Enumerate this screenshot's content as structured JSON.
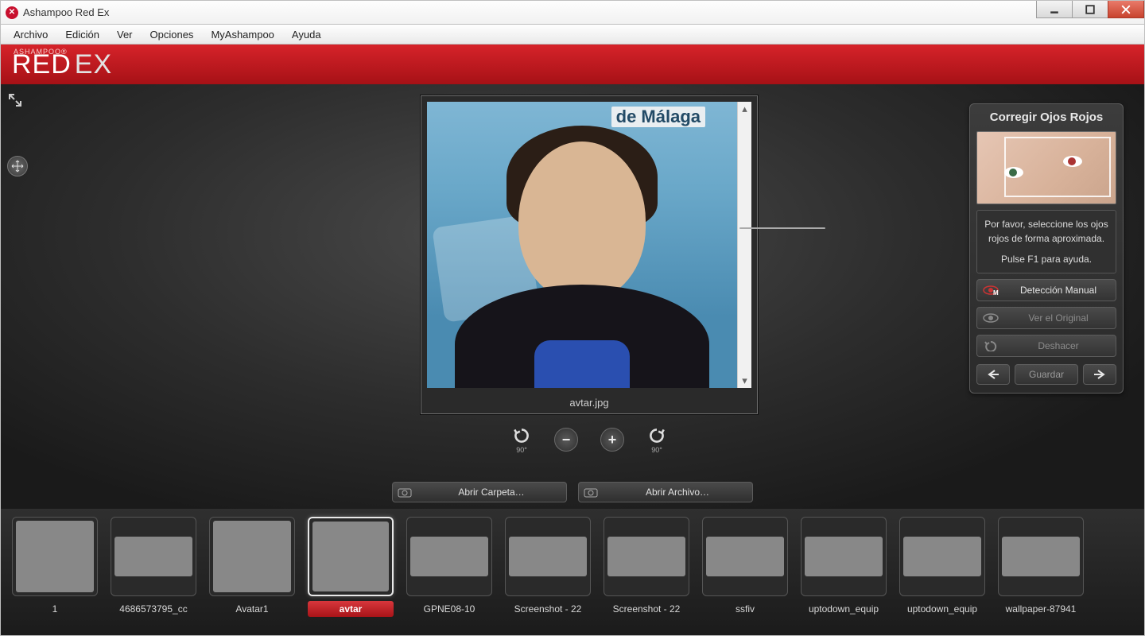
{
  "window": {
    "title": "Ashampoo Red Ex"
  },
  "brand": {
    "small": "ASHAMPOO®",
    "main": "RED",
    "suffix": "EX"
  },
  "menu": {
    "items": [
      "Archivo",
      "Edición",
      "Ver",
      "Opciones",
      "MyAshampoo",
      "Ayuda"
    ]
  },
  "viewer": {
    "filename": "avtar.jpg",
    "bg_text": "de Málaga",
    "rotate_label": "90°"
  },
  "open": {
    "folder": "Abrir Carpeta…",
    "file": "Abrir Archivo…"
  },
  "side": {
    "title": "Corregir Ojos Rojos",
    "help_line1": "Por favor, seleccione los ojos rojos de forma aproximada.",
    "help_line2": "Pulse F1 para ayuda.",
    "manual": "Detección Manual",
    "original": "Ver el Original",
    "undo": "Deshacer",
    "save": "Guardar"
  },
  "thumbs": [
    {
      "label": "1",
      "cls": "t-fry",
      "selected": false
    },
    {
      "label": "4686573795_cc",
      "cls": "t-space narrow",
      "selected": false
    },
    {
      "label": "Avatar1",
      "cls": "t-av1",
      "selected": false
    },
    {
      "label": "avtar",
      "cls": "t-avtar",
      "selected": true
    },
    {
      "label": "GPNE08-10",
      "cls": "t-gpne narrow",
      "selected": false
    },
    {
      "label": "Screenshot - 22",
      "cls": "t-ss1 narrow",
      "selected": false
    },
    {
      "label": "Screenshot - 22",
      "cls": "t-ss2 narrow",
      "selected": false
    },
    {
      "label": "ssfiv",
      "cls": "t-ssfiv narrow",
      "selected": false
    },
    {
      "label": "uptodown_equip",
      "cls": "t-utd narrow",
      "selected": false
    },
    {
      "label": "uptodown_equip",
      "cls": "t-utd narrow",
      "selected": false
    },
    {
      "label": "wallpaper-87941",
      "cls": "t-wall narrow",
      "selected": false
    }
  ]
}
